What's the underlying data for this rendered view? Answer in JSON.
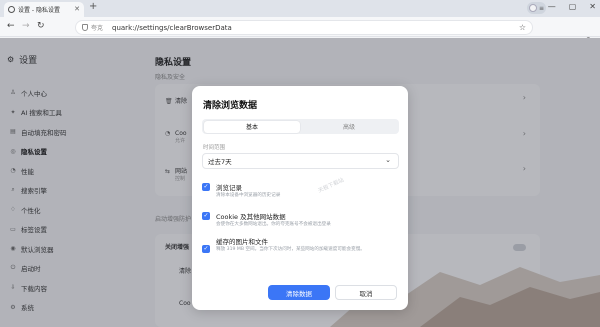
{
  "browser": {
    "tab_title": "设置 - 隐私设置",
    "new_tab": "+",
    "back": "←",
    "forward": "→",
    "reload": "↻",
    "url_brand": "夸克",
    "url": "quark://settings/clearBrowserData",
    "star": "☆",
    "ext": "⚲",
    "minimize": "—",
    "maximize": "▢",
    "close": "✕",
    "tab_close": "✕"
  },
  "sidebar": {
    "title": "设置",
    "items": [
      {
        "icon": "♙",
        "label": "个人中心"
      },
      {
        "icon": "✦",
        "label": "AI 搜索和工具"
      },
      {
        "icon": "▤",
        "label": "自动填充和密码"
      },
      {
        "icon": "◎",
        "label": "隐私设置"
      },
      {
        "icon": "◔",
        "label": "性能"
      },
      {
        "icon": "⌕",
        "label": "搜索引擎"
      },
      {
        "icon": "♢",
        "label": "个性化"
      },
      {
        "icon": "▭",
        "label": "标签设置"
      },
      {
        "icon": "◉",
        "label": "默认浏览器"
      },
      {
        "icon": "⏻",
        "label": "启动时"
      },
      {
        "icon": "⇩",
        "label": "下载内容"
      },
      {
        "icon": "⚙",
        "label": "系统"
      }
    ]
  },
  "main": {
    "title": "隐私设置",
    "section1": "隐私及安全",
    "rows": [
      {
        "icon": "🗑",
        "label": "清除",
        "sub": ""
      },
      {
        "icon": "◔",
        "label": "Coo",
        "sub": "允许"
      },
      {
        "icon": "⇆",
        "label": "网站",
        "sub": "控制"
      }
    ],
    "section2": "启动增强防护",
    "card2_rows": [
      {
        "label": "关闭增强"
      },
      {
        "label": "清除"
      },
      {
        "label": "Coo"
      }
    ]
  },
  "dialog": {
    "title": "清除浏览数据",
    "tab_basic": "基本",
    "tab_advanced": "高级",
    "range_label": "时间范围",
    "range_value": "过去7天",
    "caret": "⌄",
    "watermark": "天极下载站",
    "options": [
      {
        "title": "浏览记录",
        "desc": "清除本设备中浏览器的历史记录",
        "checked": true
      },
      {
        "title": "Cookie 及其他网站数据",
        "desc": "会使你在大多数网站退出。你的夸克账号不会被退出登录",
        "checked": true
      },
      {
        "title": "缓存的图片和文件",
        "desc": "释放 319 MB 空间。当你下次访问时，某些网站的加载速度可能会变慢。",
        "checked": true
      }
    ],
    "confirm": "清除数据",
    "cancel": "取消"
  },
  "colors": {
    "accent": "#3b76f6"
  }
}
